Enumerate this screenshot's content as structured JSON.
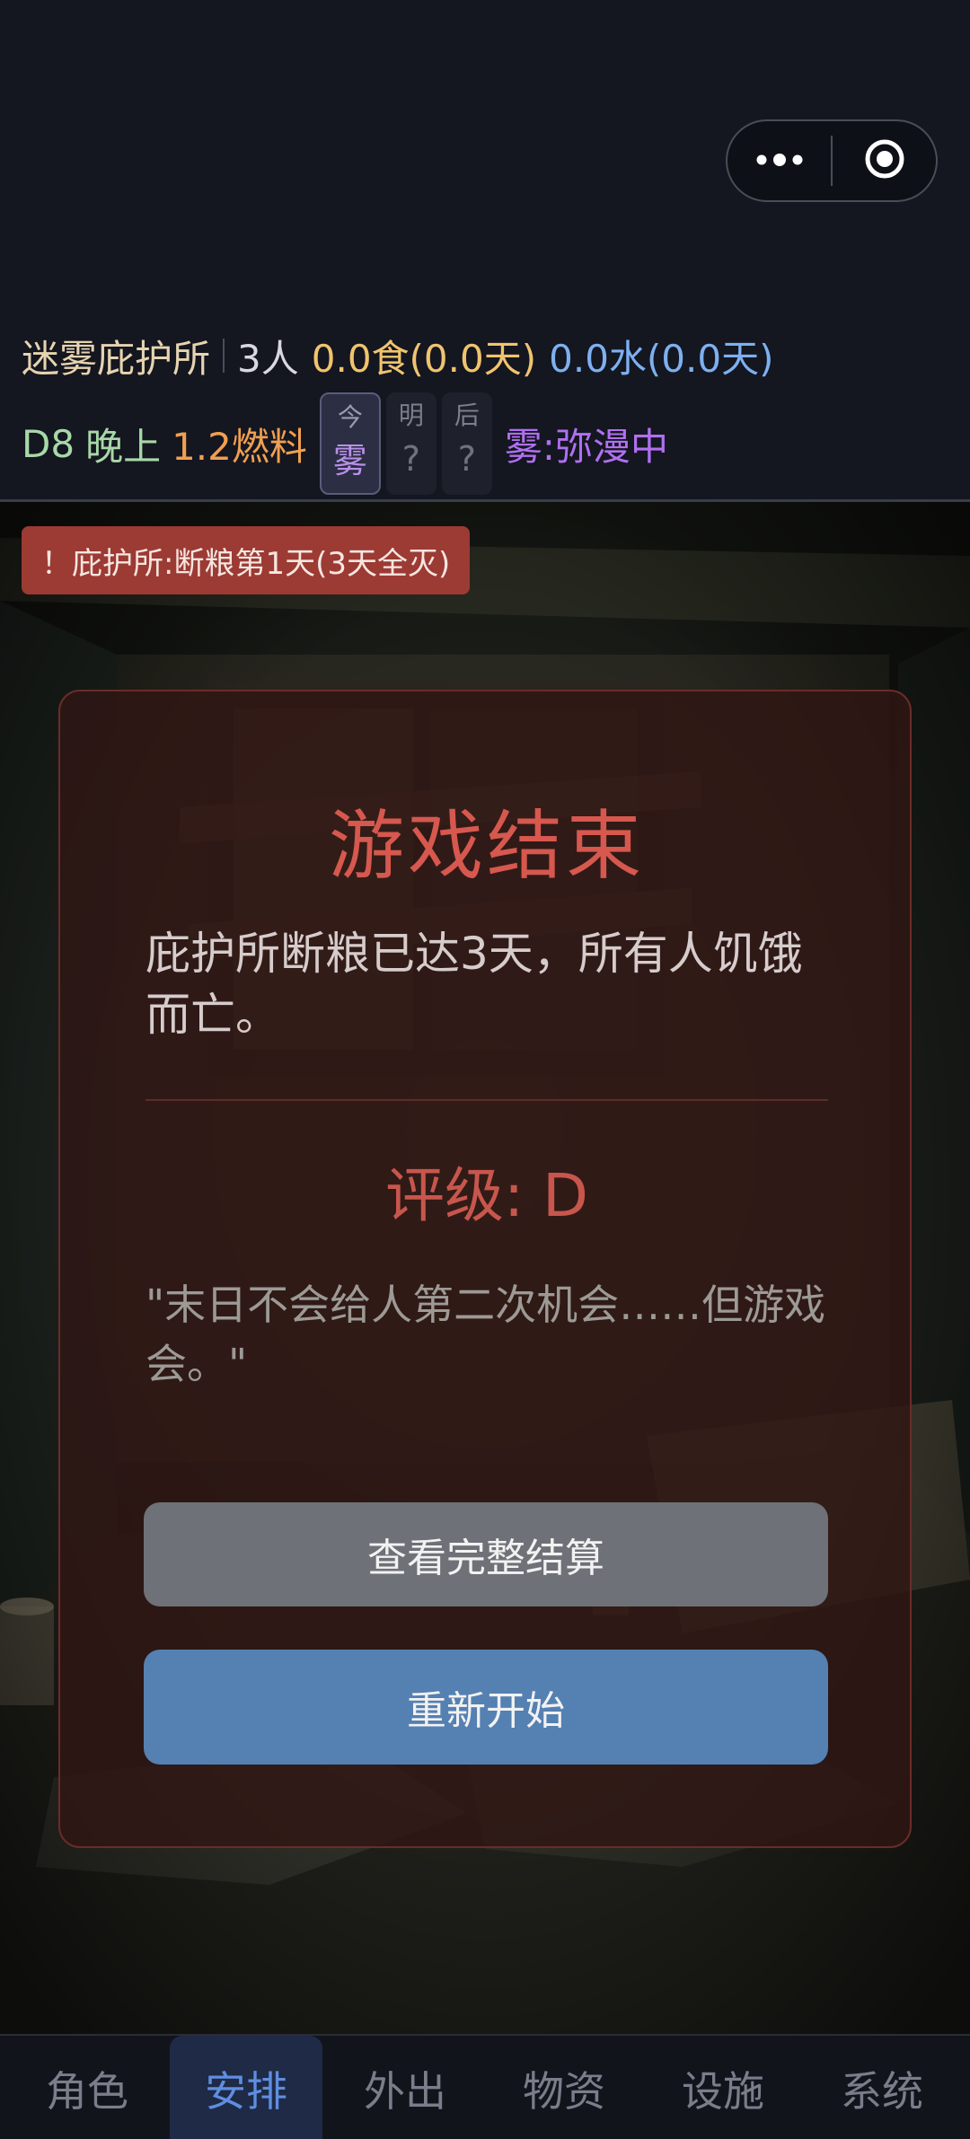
{
  "status": {
    "shelter_name": "迷雾庇护所",
    "people": "3人",
    "food": "0.0食(0.0天)",
    "water": "0.0水(0.0天)",
    "day": "D8",
    "time_of_day": "晚上",
    "fuel": "1.2燃料",
    "forecast": [
      {
        "label": "今",
        "value": "雾"
      },
      {
        "label": "明",
        "value": "?"
      },
      {
        "label": "后",
        "value": "?"
      }
    ],
    "fog_status": "雾:弥漫中"
  },
  "alert": {
    "text": "！庇护所:断粮第1天(3天全灭)"
  },
  "dialog": {
    "title": "游戏结束",
    "message": "庇护所断粮已达3天，所有人饥饿而亡。",
    "grade": "评级: D",
    "quote": "\"末日不会给人第二次机会……但游戏会。\"",
    "summary_button": "查看完整结算",
    "restart_button": "重新开始"
  },
  "tabs": [
    {
      "label": "角色"
    },
    {
      "label": "安排"
    },
    {
      "label": "外出"
    },
    {
      "label": "物资"
    },
    {
      "label": "设施"
    },
    {
      "label": "系统"
    }
  ],
  "active_tab": "安排",
  "icons": {
    "menu": "more-dots-icon",
    "close": "target-circle-icon"
  },
  "colors": {
    "alert_bg": "#9c3a34",
    "title_red": "#d6584e",
    "restart_blue": "#5580b2",
    "summary_gray": "#6e7177",
    "active_tab": "#5f8ee0"
  }
}
